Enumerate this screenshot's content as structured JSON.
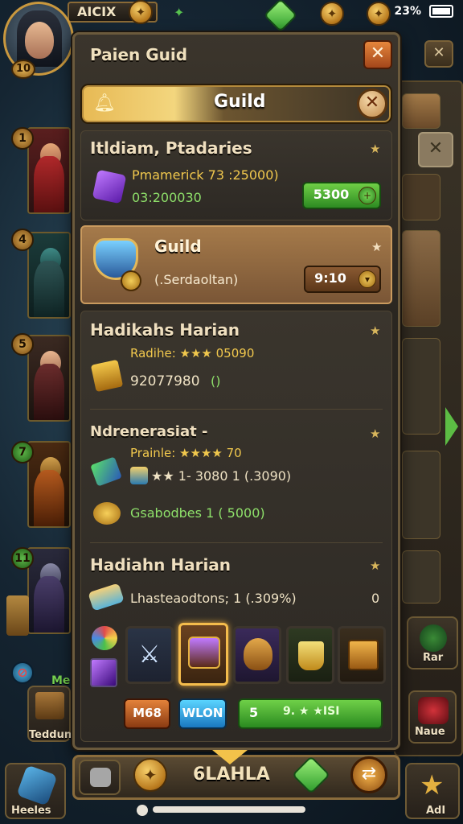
{
  "status_bar": {
    "player_name": "AICIX",
    "clock": "23%",
    "player_level": "10"
  },
  "dialog": {
    "title": "Paien Guid",
    "tab_label": "Guild"
  },
  "sections": {
    "ranking": {
      "title": "Itldiam, Ptadaries",
      "line1": "Pmamerick 73 :25000)",
      "line2": "03:200030",
      "button": "5300"
    },
    "guild": {
      "title": "Guild",
      "subtitle": "(.Serdaoltan)",
      "button": "9:10"
    },
    "daily1": {
      "title": "Hadikahs Harian",
      "line1": "Radihe: ★★★ 05090",
      "line2": "92077980",
      "line2_suffix": "()"
    },
    "daily2": {
      "title": "Ndrenerasiat -",
      "line1": "Prainle: ★★★★ 70",
      "line2": "★★ 1- 3080  1 (.3090)",
      "line3": "Gsabodbes  1  ( 5000)"
    },
    "daily3": {
      "title": "Hadiahn Harian",
      "line1": "Lhasteaodtons; 1 (.309%)",
      "line1_value": "0"
    }
  },
  "reward_slots": [
    {
      "icon": "sword-icon"
    },
    {
      "icon": "treasure-chest-icon"
    },
    {
      "icon": "helmet-hero-icon"
    },
    {
      "icon": "gold-cup-icon"
    },
    {
      "icon": "crate-icon"
    }
  ],
  "action_buttons": {
    "btn1": "M68",
    "btn2": "WLON",
    "btn3_num": "5",
    "btn3_label": "9. ★ ★ISI"
  },
  "hero_list": [
    {
      "num": "1"
    },
    {
      "num": "4"
    },
    {
      "num": "5"
    },
    {
      "num": "7"
    },
    {
      "num": "11"
    }
  ],
  "left_labels": {
    "me": "Me",
    "teddun": "Teddun",
    "heeles": "Heeles"
  },
  "right_labels": {
    "rar": "Rar",
    "naue": "Naue",
    "adl": "AdI"
  },
  "bottom_bar": {
    "label": "6LAHLA"
  },
  "colors": {
    "accent_gold": "#e7b954",
    "green_button": "#2d8a22",
    "dialog_border": "#6b5a3c"
  }
}
